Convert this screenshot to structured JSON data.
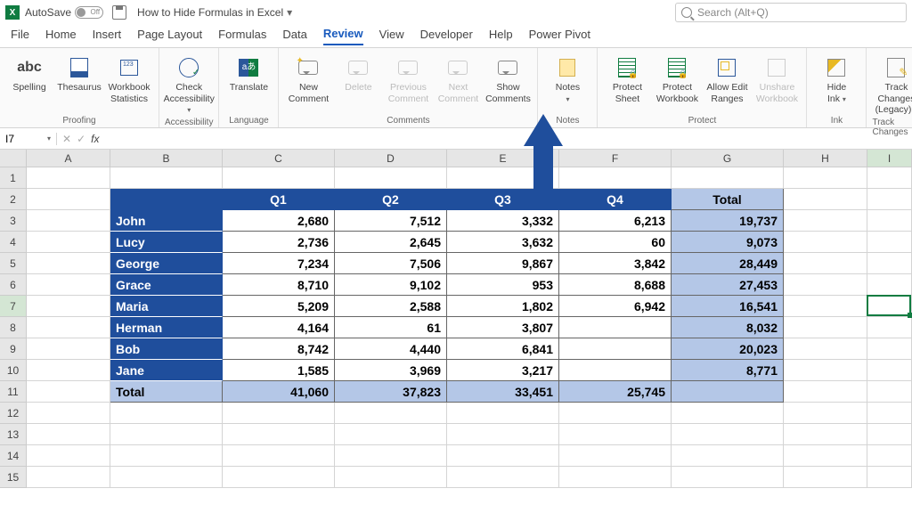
{
  "titlebar": {
    "autosave_label": "AutoSave",
    "autosave_state": "Off",
    "doc_title": "How to Hide Formulas in Excel",
    "search_placeholder": "Search (Alt+Q)"
  },
  "tabs": [
    "File",
    "Home",
    "Insert",
    "Page Layout",
    "Formulas",
    "Data",
    "Review",
    "View",
    "Developer",
    "Help",
    "Power Pivot"
  ],
  "active_tab": "Review",
  "ribbon": {
    "groups": [
      {
        "label": "Proofing",
        "items": [
          {
            "name": "spelling",
            "label": "Spelling"
          },
          {
            "name": "thesaurus",
            "label": "Thesaurus"
          },
          {
            "name": "workbook-stats",
            "label": "Workbook Statistics"
          }
        ]
      },
      {
        "label": "Accessibility",
        "items": [
          {
            "name": "check-accessibility",
            "label": "Check Accessibility",
            "dd": true
          }
        ]
      },
      {
        "label": "Language",
        "items": [
          {
            "name": "translate",
            "label": "Translate"
          }
        ]
      },
      {
        "label": "Comments",
        "items": [
          {
            "name": "new-comment",
            "label": "New Comment"
          },
          {
            "name": "delete-comment",
            "label": "Delete",
            "disabled": true
          },
          {
            "name": "prev-comment",
            "label": "Previous Comment",
            "disabled": true
          },
          {
            "name": "next-comment",
            "label": "Next Comment",
            "disabled": true
          },
          {
            "name": "show-comments",
            "label": "Show Comments"
          }
        ]
      },
      {
        "label": "Notes",
        "items": [
          {
            "name": "notes",
            "label": "Notes",
            "dd": true
          }
        ]
      },
      {
        "label": "Protect",
        "items": [
          {
            "name": "protect-sheet",
            "label": "Protect Sheet"
          },
          {
            "name": "protect-workbook",
            "label": "Protect Workbook"
          },
          {
            "name": "allow-edit-ranges",
            "label": "Allow Edit Ranges"
          },
          {
            "name": "unshare-workbook",
            "label": "Unshare Workbook",
            "disabled": true
          }
        ]
      },
      {
        "label": "Ink",
        "items": [
          {
            "name": "hide-ink",
            "label": "Hide Ink",
            "dd": true
          }
        ]
      },
      {
        "label": "Track Changes",
        "items": [
          {
            "name": "track-changes",
            "label": "Track Changes (Legacy)",
            "dd": true
          }
        ]
      }
    ]
  },
  "formula_bar": {
    "name_box": "I7",
    "formula": ""
  },
  "columns": [
    "A",
    "B",
    "C",
    "D",
    "E",
    "F",
    "G",
    "H",
    "I"
  ],
  "active_col": "I",
  "active_row": 7,
  "row_count": 15,
  "table": {
    "header_row": 2,
    "col_start": "B",
    "headers": [
      "",
      "Q1",
      "Q2",
      "Q3",
      "Q4",
      "Total"
    ],
    "rows": [
      {
        "name": "John",
        "q": [
          "2,680",
          "7,512",
          "3,332",
          "6,213"
        ],
        "total": "19,737"
      },
      {
        "name": "Lucy",
        "q": [
          "2,736",
          "2,645",
          "3,632",
          "60"
        ],
        "total": "9,073"
      },
      {
        "name": "George",
        "q": [
          "7,234",
          "7,506",
          "9,867",
          "3,842"
        ],
        "total": "28,449"
      },
      {
        "name": "Grace",
        "q": [
          "8,710",
          "9,102",
          "953",
          "8,688"
        ],
        "total": "27,453"
      },
      {
        "name": "Maria",
        "q": [
          "5,209",
          "2,588",
          "1,802",
          "6,942"
        ],
        "total": "16,541"
      },
      {
        "name": "Herman",
        "q": [
          "4,164",
          "61",
          "3,807",
          ""
        ],
        "total": "8,032"
      },
      {
        "name": "Bob",
        "q": [
          "8,742",
          "4,440",
          "6,841",
          ""
        ],
        "total": "20,023"
      },
      {
        "name": "Jane",
        "q": [
          "1,585",
          "3,969",
          "3,217",
          ""
        ],
        "total": "8,771"
      }
    ],
    "total_row": {
      "label": "Total",
      "q": [
        "41,060",
        "37,823",
        "33,451",
        "25,745"
      ],
      "total": ""
    }
  }
}
